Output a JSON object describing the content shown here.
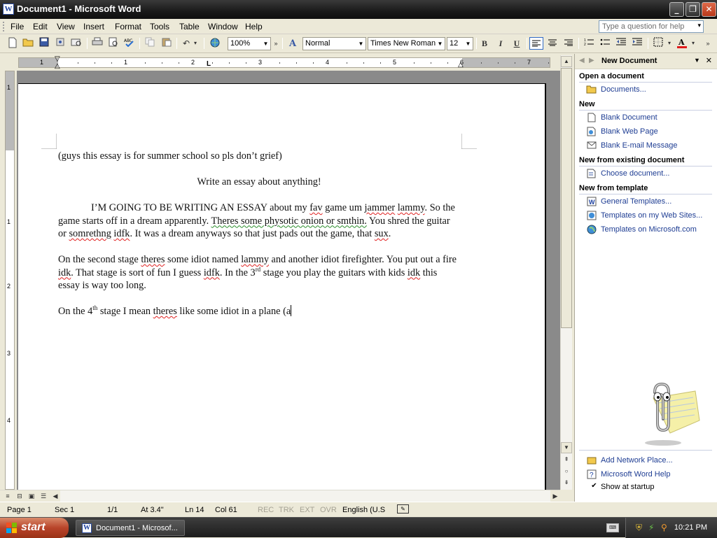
{
  "window": {
    "title": "Document1 - Microsoft Word",
    "app_glyph": "W"
  },
  "menu": {
    "items": [
      "File",
      "Edit",
      "View",
      "Insert",
      "Format",
      "Tools",
      "Table",
      "Window",
      "Help"
    ],
    "help_placeholder": "Type a question for help"
  },
  "toolbar": {
    "zoom": "100%",
    "style": "Normal",
    "font": "Times New Roman",
    "size": "12",
    "bold": "B",
    "italic": "I",
    "underline": "U",
    "font_color": "#e01b1b"
  },
  "ruler": {
    "h_numbers": [
      "1",
      "1",
      "2",
      "3",
      "4",
      "5",
      "6",
      "7"
    ],
    "v_numbers": [
      "1",
      "1",
      "2",
      "3",
      "4"
    ]
  },
  "document": {
    "line1": "(guys this essay is for summer school so pls don’t grief)",
    "title": "Write an essay about anything!",
    "p1": {
      "a": "I’M GOING TO BE WRITING AN ESSAY about my ",
      "fav": "fav",
      "b": " game um ",
      "jammer": "jammer",
      "c": " ",
      "lammy": "lammy",
      "d": ". So the game starts off in a dream apparently. ",
      "g1": "Theres some physotic onion or smthin.",
      "e": " You shred the guitar or ",
      "somrethng": "somrethng",
      "f": " ",
      "idfk": "idfk",
      "g": ". It was a dream anyways so that just pads out the game, that ",
      "sux": "sux",
      "h": "."
    },
    "p2": {
      "a": "On the second stage ",
      "theres": "theres",
      "b": " some idiot named ",
      "lammy": "lammy",
      "c": " and another idiot firefighter. You put out a fire ",
      "idk": "idk",
      "d": ". That stage is sort of fun I guess ",
      "idfk": "idfk",
      "e": ". In the 3",
      "sup": "rd",
      "f": " stage you play the guitars with kids ",
      "idk2": "idk",
      "g": " this essay is way too long."
    },
    "p3": {
      "a": "On the 4",
      "sup": "th",
      "b": " stage I mean ",
      "theres": "theres",
      "c": " like some idiot in a plane (a"
    }
  },
  "taskpane": {
    "title": "New Document",
    "open_header": "Open a document",
    "documents": "Documents...",
    "new_header": "New",
    "blank_document": "Blank Document",
    "blank_web": "Blank Web Page",
    "blank_email": "Blank E-mail Message",
    "existing_header": "New from existing document",
    "choose": "Choose document...",
    "template_header": "New from template",
    "general": "General Templates...",
    "websites": "Templates on my Web Sites...",
    "ms": "Templates on Microsoft.com",
    "network": "Add Network Place...",
    "word_help": "Microsoft Word Help",
    "show_startup": "Show at startup"
  },
  "status": {
    "page": "Page 1",
    "sec": "Sec 1",
    "pages": "1/1",
    "at": "At 3.4\"",
    "ln": "Ln 14",
    "col": "Col 61",
    "rec": "REC",
    "trk": "TRK",
    "ext": "EXT",
    "ovr": "OVR",
    "lang": "English (U.S"
  },
  "taskbar": {
    "start": "start",
    "item": "Document1 - Microsof...",
    "clock": "10:21 PM"
  }
}
